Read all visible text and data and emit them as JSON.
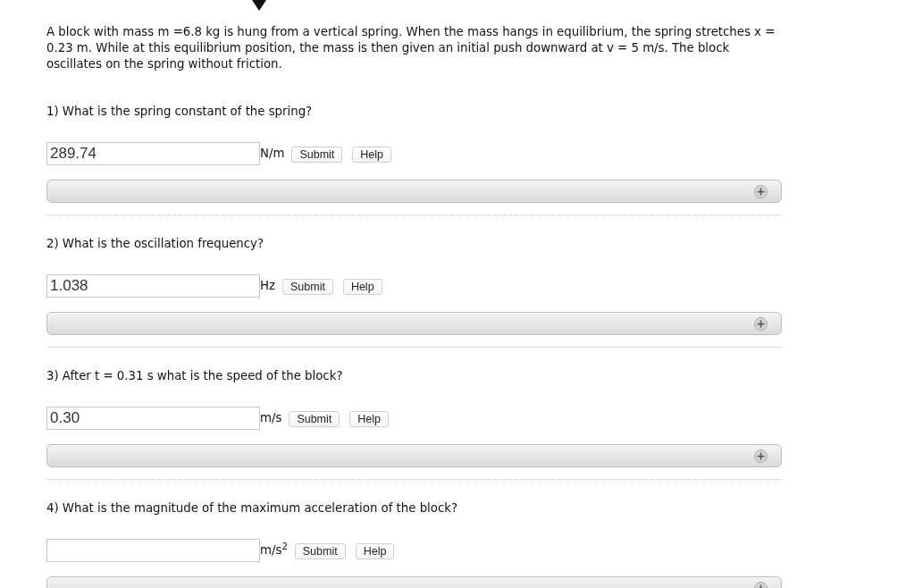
{
  "intro": "A block with mass m =6.8 kg is hung from a vertical spring. When the mass hangs in equilibrium, the spring stretches x = 0.23 m. While at this equilibrium position, the mass is then given an initial push downward at v = 5 m/s. The block oscillates on the spring without friction.",
  "questions": [
    {
      "prompt": "1) What is the spring constant of the spring?",
      "answer": "289.74",
      "unit": "N/m",
      "buttons": [
        "Submit",
        "Help"
      ],
      "expanded": false
    },
    {
      "prompt": "2) What is the oscillation frequency?",
      "answer": "1.038",
      "unit": "Hz",
      "buttons": [
        "Submit",
        "Help"
      ],
      "expanded": false
    },
    {
      "prompt": "3) After t = 0.31 s what is the speed of the block?",
      "answer": "0.30",
      "unit": "m/s",
      "buttons": [
        "Submit",
        "Help"
      ],
      "expanded": false
    },
    {
      "prompt": "4) What is the magnitude of the maximum acceleration of the block?",
      "unit": "m/s$^{2}$",
      "buttons": [
        "Submit",
        "Help"
      ],
      "expanded": false
    }
  ]
}
